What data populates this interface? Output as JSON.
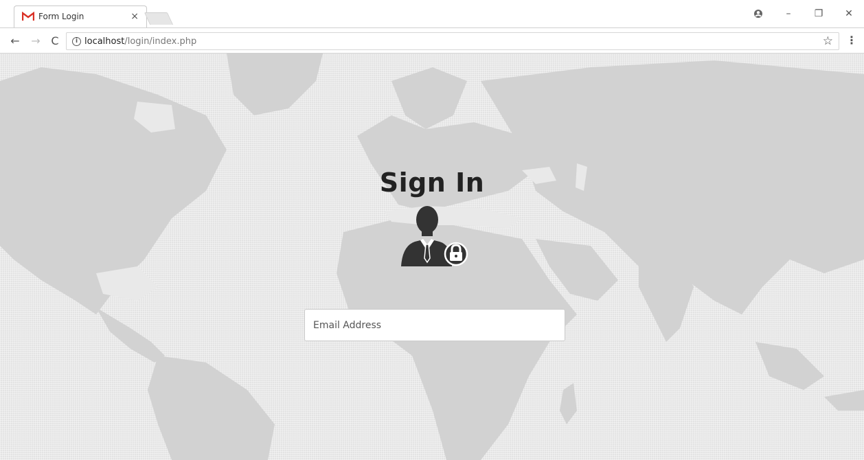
{
  "browser": {
    "tab_title": "Form Login",
    "tab_close": "×",
    "url_host": "localhost",
    "url_path": "/login/index.php",
    "window_controls": {
      "minimize": "–",
      "restore": "❐",
      "close": "✕"
    }
  },
  "page": {
    "title": "Sign In",
    "icon": "user-lock-icon",
    "email": {
      "placeholder": "Email Address",
      "value": ""
    }
  },
  "colors": {
    "page_background": "#e3e3e3",
    "map_land": "#d2d2d2",
    "icon": "#333333",
    "gmail_red": "#d93025"
  }
}
